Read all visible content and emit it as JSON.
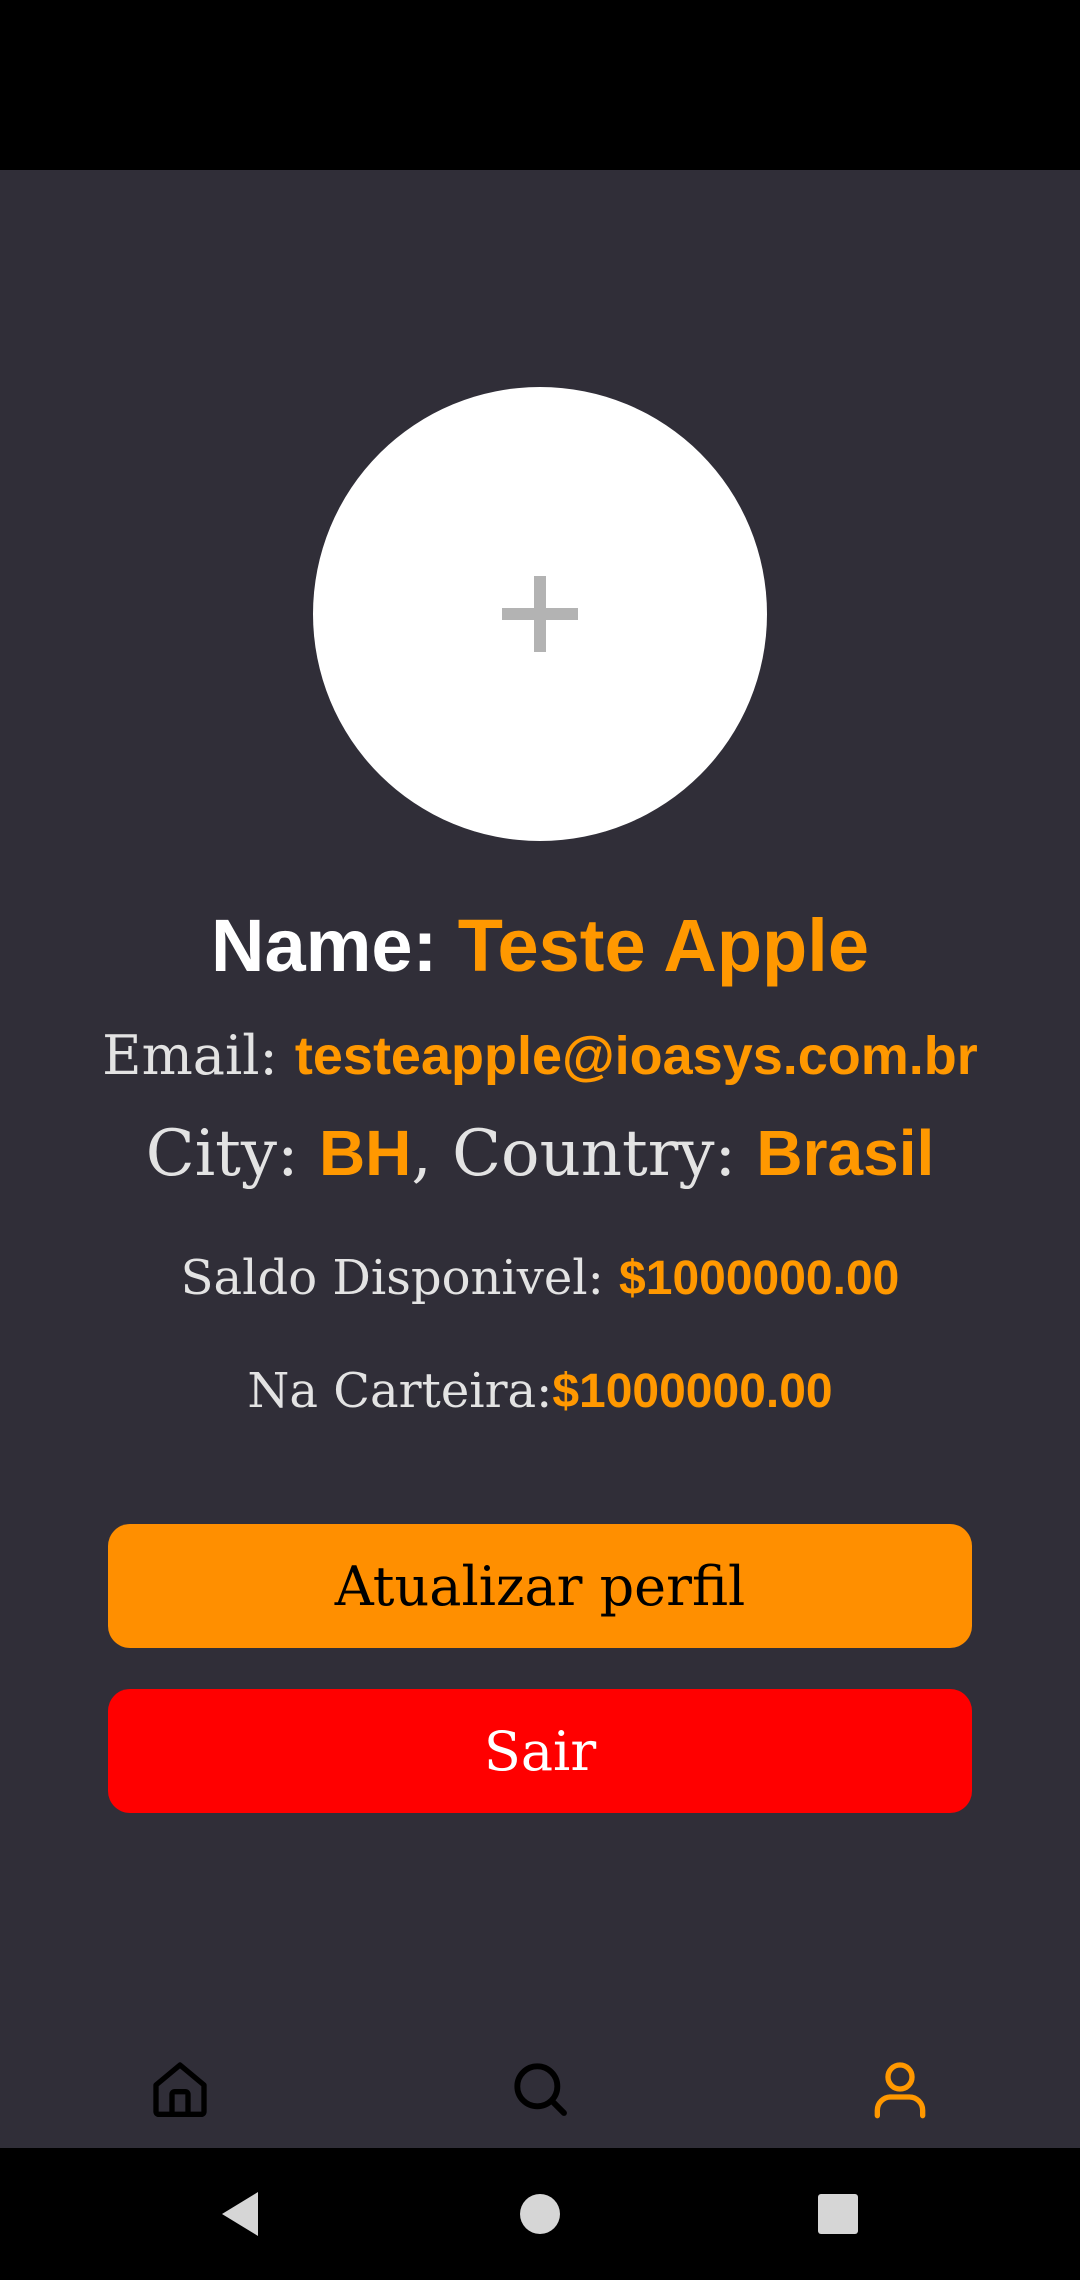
{
  "profile": {
    "name_label": "Name: ",
    "name_value": "Teste Apple",
    "email_label": "Email: ",
    "email_value": "testeapple@ioasys.com.br",
    "city_label": "City: ",
    "city_value": "BH",
    "country_label": ", Country: ",
    "country_value": "Brasil",
    "saldo_label": "Saldo Disponivel: ",
    "saldo_value": "$1000000.00",
    "carteira_label": "Na Carteira:",
    "carteira_value": "$1000000.00"
  },
  "buttons": {
    "update_label": "Atualizar perfil",
    "logout_label": "Sair"
  },
  "tabbar": {
    "items": [
      {
        "icon": "home-icon",
        "active": false
      },
      {
        "icon": "search-icon",
        "active": false
      },
      {
        "icon": "user-icon",
        "active": true
      }
    ]
  },
  "avatar": {
    "icon": "plus-icon"
  },
  "system_nav": {
    "items": [
      "back-icon",
      "home-circle-icon",
      "recents-icon"
    ]
  },
  "colors": {
    "background": "#302e38",
    "accent": "#ff9800",
    "update_button": "#ff8f00",
    "logout_button": "#ff0000",
    "tab_inactive": "#000000",
    "tab_active": "#ff9800"
  }
}
